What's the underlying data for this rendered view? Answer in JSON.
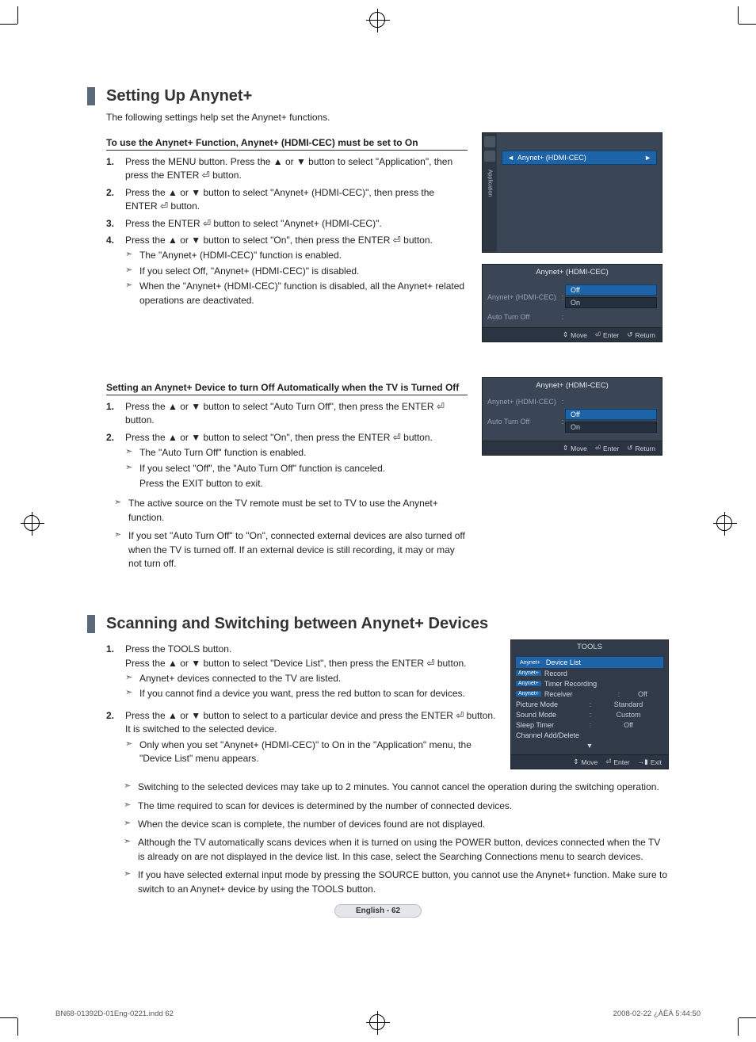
{
  "sec1": {
    "title": "Setting Up Anynet+",
    "intro": "The following settings help set the Anynet+ functions.",
    "subA": {
      "heading": "To use the Anynet+ Function, Anynet+ (HDMI-CEC) must be set to On",
      "steps": [
        {
          "n": "1.",
          "t": "Press the MENU button. Press the ▲ or ▼ button to select \"Application\", then press the ENTER ⏎ button."
        },
        {
          "n": "2.",
          "t": "Press the ▲ or ▼ button to select \"Anynet+ (HDMI-CEC)\", then press the ENTER ⏎ button."
        },
        {
          "n": "3.",
          "t": "Press the ENTER ⏎ button to select \"Anynet+ (HDMI-CEC)\"."
        },
        {
          "n": "4.",
          "t": "Press the ▲ or ▼ button to select \"On\", then press the ENTER ⏎ button."
        }
      ],
      "bullets": [
        "The \"Anynet+ (HDMI-CEC)\" function is enabled.",
        "If you select Off, \"Anynet+ (HDMI-CEC)\" is disabled.",
        "When the \"Anynet+ (HDMI-CEC)\" function is disabled, all the Anynet+ related operations are deactivated."
      ]
    },
    "subB": {
      "heading": "Setting an Anynet+ Device to turn Off Automatically when the TV is Turned Off",
      "steps": [
        {
          "n": "1.",
          "t": "Press the ▲ or ▼ button to select \"Auto Turn Off\", then press the ENTER ⏎ button."
        },
        {
          "n": "2.",
          "t": "Press the ▲ or ▼ button to select \"On\", then press the ENTER ⏎ button."
        }
      ],
      "bullets2": [
        "The \"Auto Turn Off\" function is enabled.",
        "If you select \"Off\", the \"Auto Turn Off\" function is canceled."
      ],
      "exitline": "Press the EXIT button to exit.",
      "notes": [
        "The active source on the TV remote must be set to TV to use the Anynet+ function.",
        "If you set \"Auto Turn Off\" to \"On\", connected external devices are also turned off when the TV is turned off. If an external device is still recording, it may or may not turn off."
      ]
    },
    "panels": {
      "app": {
        "sidebar_label": "Application",
        "row": "Anynet+ (HDMI-CEC)"
      },
      "cec1": {
        "title": "Anynet+ (HDMI-CEC)",
        "r1k": "Anynet+ (HDMI-CEC)",
        "r2k": "Auto Turn Off",
        "opt_off": "Off",
        "opt_on": "On",
        "status_move": "Move",
        "status_enter": "Enter",
        "status_return": "Return"
      },
      "cec2": {
        "title": "Anynet+ (HDMI-CEC)",
        "r1k": "Anynet+ (HDMI-CEC)",
        "r2k": "Auto Turn Off",
        "opt_off": "Off",
        "opt_on": "On",
        "status_move": "Move",
        "status_enter": "Enter",
        "status_return": "Return"
      }
    }
  },
  "sec2": {
    "title": "Scanning and Switching between Anynet+ Devices",
    "steps": [
      {
        "n": "1.",
        "t": "Press the TOOLS button.",
        "t2": "Press the ▲ or ▼ button to select \"Device List\", then press the ENTER ⏎ button.",
        "b": [
          "Anynet+ devices connected to the TV are listed.",
          "If you cannot find a device you want, press the red button to scan for devices."
        ]
      },
      {
        "n": "2.",
        "t": "Press the ▲ or ▼ button to select to a particular device and press the ENTER ⏎ button. It is switched to the selected device.",
        "b": [
          "Only when you set \"Anynet+ (HDMI-CEC)\" to On in the \"Application\" menu, the \"Device List\" menu appears."
        ]
      }
    ],
    "notes": [
      "Switching to the selected devices may take up to 2 minutes. You cannot cancel the operation during the switching operation.",
      "The time required to scan for devices is determined by the number of connected devices.",
      "When the device scan is complete, the number of devices found are not displayed.",
      "Although the TV automatically scans devices when it is turned on using the POWER button, devices connected when the TV is already on are not displayed in the device list. In this case, select the Searching Connections menu to search devices.",
      "If you have selected external input mode by pressing the SOURCE button, you cannot use the Anynet+ function. Make sure to switch to an Anynet+ device by using the TOOLS button."
    ],
    "tools": {
      "title": "TOOLS",
      "rows": [
        {
          "tag": "Anynet+",
          "k": "Device List",
          "v": ""
        },
        {
          "tag": "Anynet+",
          "k": "Record",
          "v": ""
        },
        {
          "tag": "Anynet+",
          "k": "Timer Recording",
          "v": ""
        },
        {
          "tag": "Anynet+",
          "k": "Receiver",
          "v": "Off"
        },
        {
          "tag": "",
          "k": "Picture Mode",
          "v": "Standard"
        },
        {
          "tag": "",
          "k": "Sound Mode",
          "v": "Custom"
        },
        {
          "tag": "",
          "k": "Sleep Timer",
          "v": "Off"
        },
        {
          "tag": "",
          "k": "Channel Add/Delete",
          "v": ""
        }
      ],
      "status_move": "Move",
      "status_enter": "Enter",
      "status_exit": "Exit"
    }
  },
  "page_label": "English - 62",
  "footer_left": "BN68-01392D-01Eng-0221.indd   62",
  "footer_right": "2008-02-22   ¿ÀÈÄ 5:44:50"
}
